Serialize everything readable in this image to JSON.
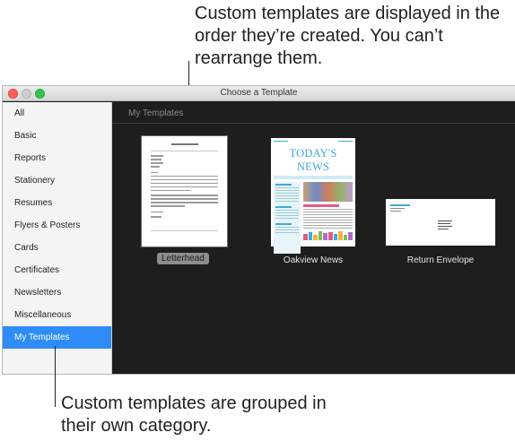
{
  "callouts": {
    "top": "Custom templates are displayed in the order they’re created. You can’t rearrange them.",
    "bottom": "Custom templates are grouped in their own category."
  },
  "window": {
    "title": "Choose a Template"
  },
  "sidebar": {
    "items": [
      {
        "label": "All"
      },
      {
        "label": "Basic"
      },
      {
        "label": "Reports"
      },
      {
        "label": "Stationery"
      },
      {
        "label": "Resumes"
      },
      {
        "label": "Flyers & Posters"
      },
      {
        "label": "Cards"
      },
      {
        "label": "Certificates"
      },
      {
        "label": "Newsletters"
      },
      {
        "label": "Miscellaneous"
      },
      {
        "label": "My Templates"
      }
    ],
    "selected": "My Templates"
  },
  "content": {
    "section_title": "My Templates",
    "templates": [
      {
        "name": "Letterhead",
        "selected": true
      },
      {
        "name": "Oakview News",
        "thumb_heading": "TODAY'S NEWS"
      },
      {
        "name": "Return Envelope"
      }
    ]
  },
  "colors": {
    "accent": "#2f8cf6",
    "content_bg": "#1e1e1e",
    "sidebar_bg": "#f4f4f4",
    "news_heading": "#3fa9dc"
  }
}
